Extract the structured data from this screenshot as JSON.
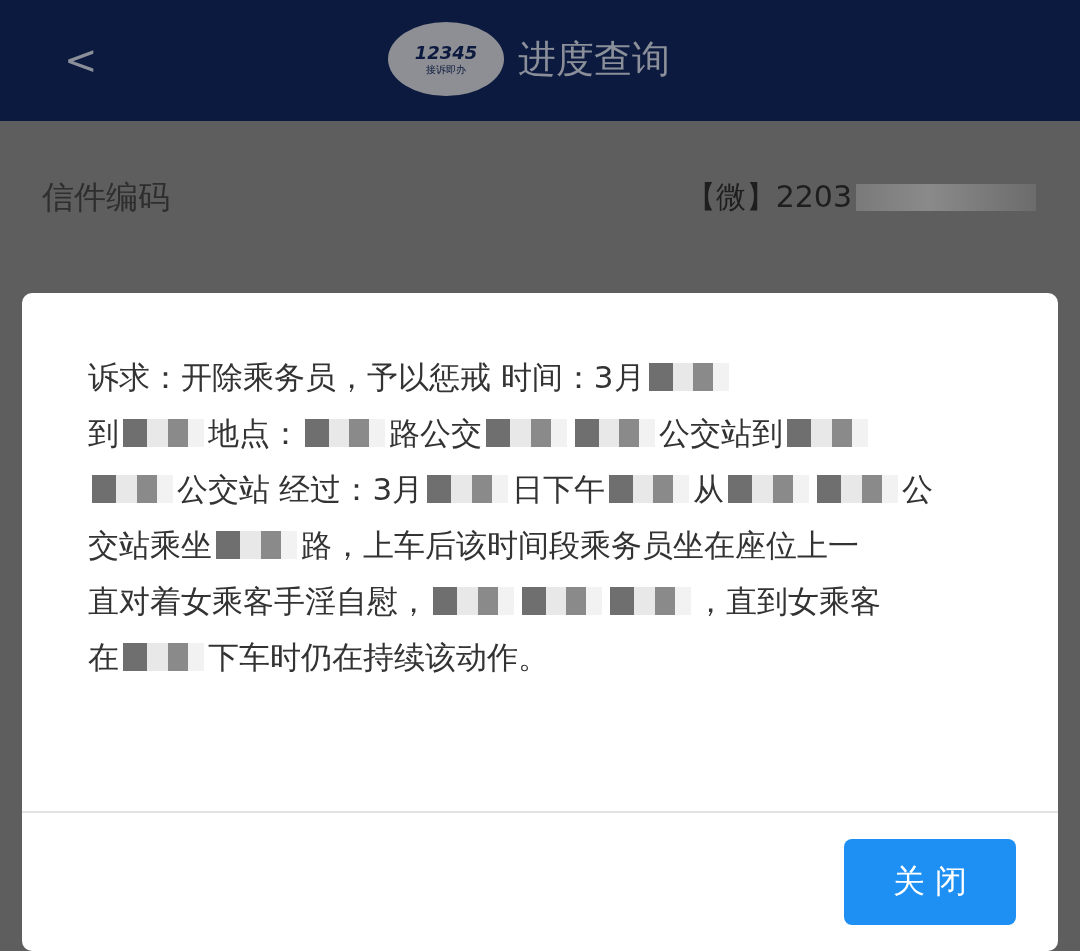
{
  "header": {
    "back": "<",
    "logo_number": "12345",
    "logo_caption": "接诉即办",
    "title": "进度查询"
  },
  "field": {
    "label": "信件编码",
    "value": [
      {
        "kind": "text",
        "text": "【微】2203"
      },
      {
        "kind": "mask"
      }
    ]
  },
  "dialog": {
    "lines": [
      [
        {
          "kind": "text",
          "text": "诉求：开除乘务员，予以惩戒 时间：3月"
        },
        {
          "kind": "mask"
        }
      ],
      [
        {
          "kind": "text",
          "text": "到"
        },
        {
          "kind": "mask"
        },
        {
          "kind": "text",
          "text": "地点："
        },
        {
          "kind": "mask"
        },
        {
          "kind": "text",
          "text": "路公交"
        },
        {
          "kind": "mask"
        },
        {
          "kind": "mask"
        },
        {
          "kind": "text",
          "text": "公交站到"
        },
        {
          "kind": "mask"
        }
      ],
      [
        {
          "kind": "mask"
        },
        {
          "kind": "text",
          "text": "公交站 经过：3月"
        },
        {
          "kind": "mask"
        },
        {
          "kind": "text",
          "text": "日下午"
        },
        {
          "kind": "mask"
        },
        {
          "kind": "text",
          "text": "从"
        },
        {
          "kind": "mask"
        },
        {
          "kind": "mask"
        },
        {
          "kind": "text",
          "text": "公"
        }
      ],
      [
        {
          "kind": "text",
          "text": "交站乘坐"
        },
        {
          "kind": "mask"
        },
        {
          "kind": "text",
          "text": "路，上车后该时间段乘务员坐在座位上一"
        }
      ],
      [
        {
          "kind": "text",
          "text": "直对着女乘客手淫自慰，"
        },
        {
          "kind": "mask"
        },
        {
          "kind": "mask"
        },
        {
          "kind": "mask"
        },
        {
          "kind": "text",
          "text": "，直到女乘客"
        }
      ],
      [
        {
          "kind": "text",
          "text": "在"
        },
        {
          "kind": "mask"
        },
        {
          "kind": "text",
          "text": "下车时仍在持续该动作。"
        }
      ]
    ],
    "button": "关 闭"
  }
}
